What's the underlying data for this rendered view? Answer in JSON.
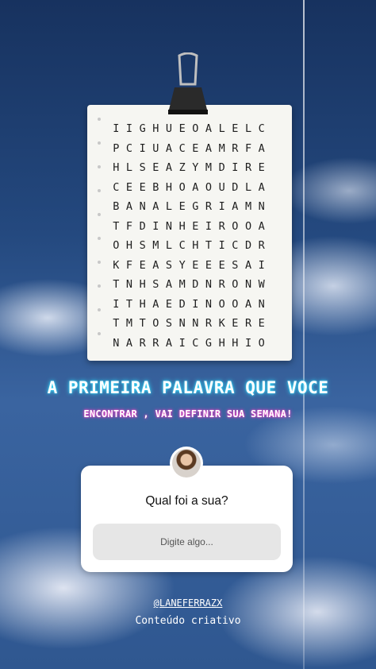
{
  "puzzle": {
    "rows": [
      "IIGHUEOALELC",
      "PCIUACEAMRFA",
      "HLSEAZYMDIRE",
      "CEEBHOAOUDLA",
      "BANALEGRIAMN",
      "TFDINHEIROOA",
      "OHSMLCHTICDR",
      "KFEASYEEESAI",
      "TNHSAMDNRONW",
      "ITHAEDINOOAN",
      "TMTOSNNRKERE",
      "NARRAICGHHIO"
    ]
  },
  "headline": "A PRIMEIRA PALAVRA QUE VOCE",
  "subheadline": "ENCONTRAR , VAI DEFINIR SUA SEMANA!",
  "question_sticker": {
    "question": "Qual foi a sua?",
    "placeholder": "Digite algo..."
  },
  "footer": {
    "handle": "@LANEFERRAZX",
    "tagline": "Conteúdo criativo"
  },
  "colors": {
    "headline_glow": "#36e0ff",
    "subheadline_glow": "#ff3fc8",
    "sky": "#24497f"
  }
}
